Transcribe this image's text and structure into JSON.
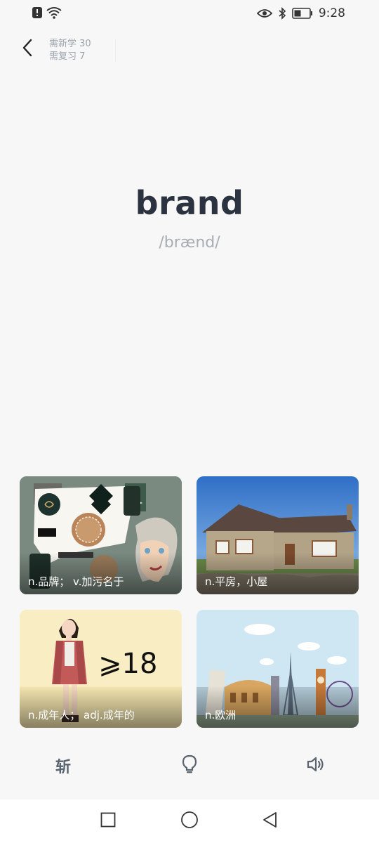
{
  "status_bar": {
    "time": "9:28",
    "icons": [
      "alert-icon",
      "wifi-icon",
      "eye-icon",
      "bluetooth-icon",
      "battery-icon"
    ]
  },
  "header": {
    "new_to_learn": "需新学 30",
    "to_review": "需复习 7"
  },
  "word": {
    "text": "brand",
    "phonetic": "/brænd/"
  },
  "options": [
    {
      "caption": "n.品牌；  v.加污名于",
      "image": "perfume-brands-illustration"
    },
    {
      "caption": "n.平房，小屋",
      "image": "bungalow-photo"
    },
    {
      "caption": "n.成年人；   adj.成年的",
      "image": "adult-woman-18-illustration",
      "overlay_text": "⩾18"
    },
    {
      "caption": "n.欧洲",
      "image": "europe-landmarks-illustration"
    }
  ],
  "toolbar": {
    "slash_label": "斩",
    "hint_icon": "lightbulb-icon",
    "audio_icon": "speaker-icon"
  },
  "colors": {
    "background": "#f7f7f7",
    "word": "#2b3240",
    "phonetic": "#a8adb4",
    "counter": "#9aa3ad",
    "toolbar_icon": "#5a6470"
  }
}
